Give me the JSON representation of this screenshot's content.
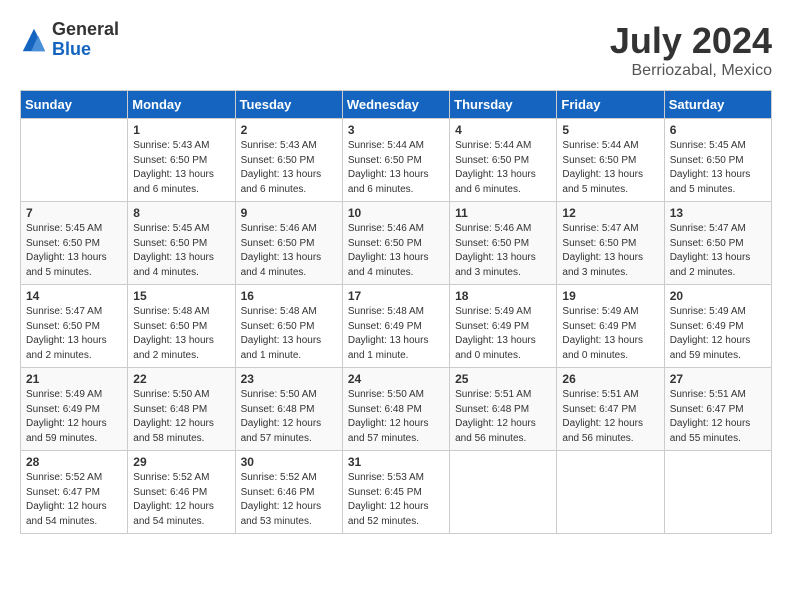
{
  "header": {
    "logo_general": "General",
    "logo_blue": "Blue",
    "month_year": "July 2024",
    "location": "Berriozabal, Mexico"
  },
  "days_of_week": [
    "Sunday",
    "Monday",
    "Tuesday",
    "Wednesday",
    "Thursday",
    "Friday",
    "Saturday"
  ],
  "weeks": [
    [
      {
        "day": "",
        "info": ""
      },
      {
        "day": "1",
        "info": "Sunrise: 5:43 AM\nSunset: 6:50 PM\nDaylight: 13 hours\nand 6 minutes."
      },
      {
        "day": "2",
        "info": "Sunrise: 5:43 AM\nSunset: 6:50 PM\nDaylight: 13 hours\nand 6 minutes."
      },
      {
        "day": "3",
        "info": "Sunrise: 5:44 AM\nSunset: 6:50 PM\nDaylight: 13 hours\nand 6 minutes."
      },
      {
        "day": "4",
        "info": "Sunrise: 5:44 AM\nSunset: 6:50 PM\nDaylight: 13 hours\nand 6 minutes."
      },
      {
        "day": "5",
        "info": "Sunrise: 5:44 AM\nSunset: 6:50 PM\nDaylight: 13 hours\nand 5 minutes."
      },
      {
        "day": "6",
        "info": "Sunrise: 5:45 AM\nSunset: 6:50 PM\nDaylight: 13 hours\nand 5 minutes."
      }
    ],
    [
      {
        "day": "7",
        "info": "Sunrise: 5:45 AM\nSunset: 6:50 PM\nDaylight: 13 hours\nand 5 minutes."
      },
      {
        "day": "8",
        "info": "Sunrise: 5:45 AM\nSunset: 6:50 PM\nDaylight: 13 hours\nand 4 minutes."
      },
      {
        "day": "9",
        "info": "Sunrise: 5:46 AM\nSunset: 6:50 PM\nDaylight: 13 hours\nand 4 minutes."
      },
      {
        "day": "10",
        "info": "Sunrise: 5:46 AM\nSunset: 6:50 PM\nDaylight: 13 hours\nand 4 minutes."
      },
      {
        "day": "11",
        "info": "Sunrise: 5:46 AM\nSunset: 6:50 PM\nDaylight: 13 hours\nand 3 minutes."
      },
      {
        "day": "12",
        "info": "Sunrise: 5:47 AM\nSunset: 6:50 PM\nDaylight: 13 hours\nand 3 minutes."
      },
      {
        "day": "13",
        "info": "Sunrise: 5:47 AM\nSunset: 6:50 PM\nDaylight: 13 hours\nand 2 minutes."
      }
    ],
    [
      {
        "day": "14",
        "info": "Sunrise: 5:47 AM\nSunset: 6:50 PM\nDaylight: 13 hours\nand 2 minutes."
      },
      {
        "day": "15",
        "info": "Sunrise: 5:48 AM\nSunset: 6:50 PM\nDaylight: 13 hours\nand 2 minutes."
      },
      {
        "day": "16",
        "info": "Sunrise: 5:48 AM\nSunset: 6:50 PM\nDaylight: 13 hours\nand 1 minute."
      },
      {
        "day": "17",
        "info": "Sunrise: 5:48 AM\nSunset: 6:49 PM\nDaylight: 13 hours\nand 1 minute."
      },
      {
        "day": "18",
        "info": "Sunrise: 5:49 AM\nSunset: 6:49 PM\nDaylight: 13 hours\nand 0 minutes."
      },
      {
        "day": "19",
        "info": "Sunrise: 5:49 AM\nSunset: 6:49 PM\nDaylight: 13 hours\nand 0 minutes."
      },
      {
        "day": "20",
        "info": "Sunrise: 5:49 AM\nSunset: 6:49 PM\nDaylight: 12 hours\nand 59 minutes."
      }
    ],
    [
      {
        "day": "21",
        "info": "Sunrise: 5:49 AM\nSunset: 6:49 PM\nDaylight: 12 hours\nand 59 minutes."
      },
      {
        "day": "22",
        "info": "Sunrise: 5:50 AM\nSunset: 6:48 PM\nDaylight: 12 hours\nand 58 minutes."
      },
      {
        "day": "23",
        "info": "Sunrise: 5:50 AM\nSunset: 6:48 PM\nDaylight: 12 hours\nand 57 minutes."
      },
      {
        "day": "24",
        "info": "Sunrise: 5:50 AM\nSunset: 6:48 PM\nDaylight: 12 hours\nand 57 minutes."
      },
      {
        "day": "25",
        "info": "Sunrise: 5:51 AM\nSunset: 6:48 PM\nDaylight: 12 hours\nand 56 minutes."
      },
      {
        "day": "26",
        "info": "Sunrise: 5:51 AM\nSunset: 6:47 PM\nDaylight: 12 hours\nand 56 minutes."
      },
      {
        "day": "27",
        "info": "Sunrise: 5:51 AM\nSunset: 6:47 PM\nDaylight: 12 hours\nand 55 minutes."
      }
    ],
    [
      {
        "day": "28",
        "info": "Sunrise: 5:52 AM\nSunset: 6:47 PM\nDaylight: 12 hours\nand 54 minutes."
      },
      {
        "day": "29",
        "info": "Sunrise: 5:52 AM\nSunset: 6:46 PM\nDaylight: 12 hours\nand 54 minutes."
      },
      {
        "day": "30",
        "info": "Sunrise: 5:52 AM\nSunset: 6:46 PM\nDaylight: 12 hours\nand 53 minutes."
      },
      {
        "day": "31",
        "info": "Sunrise: 5:53 AM\nSunset: 6:45 PM\nDaylight: 12 hours\nand 52 minutes."
      },
      {
        "day": "",
        "info": ""
      },
      {
        "day": "",
        "info": ""
      },
      {
        "day": "",
        "info": ""
      }
    ]
  ]
}
